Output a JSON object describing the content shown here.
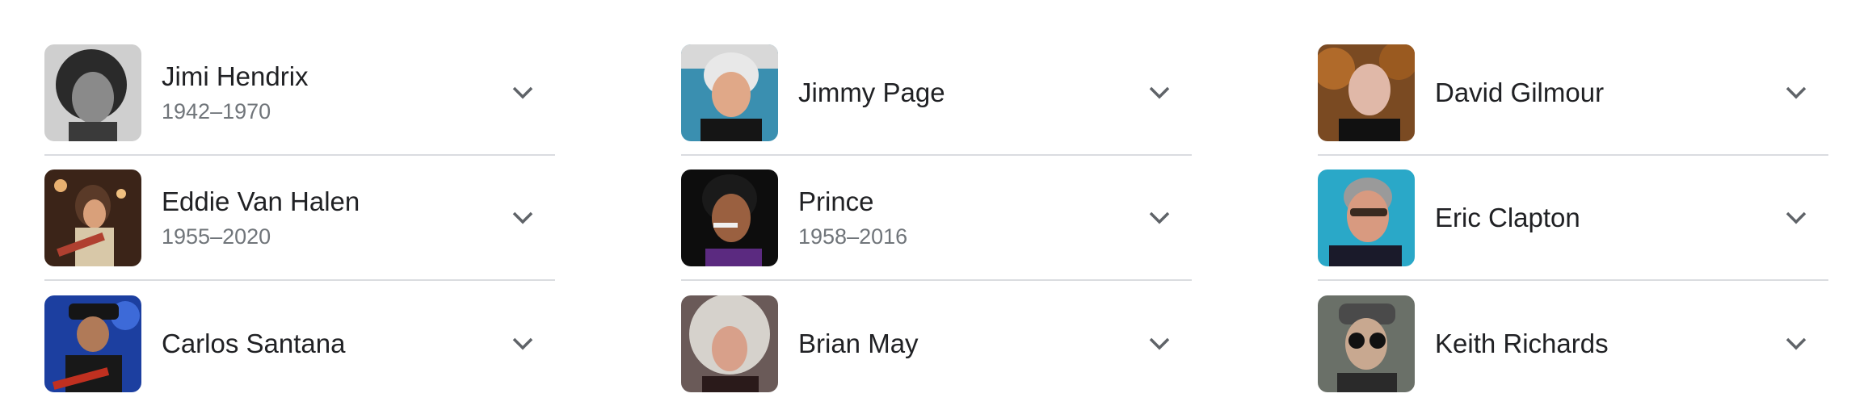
{
  "columns": [
    {
      "items": [
        {
          "name": "Jimi Hendrix",
          "years": "1942–1970",
          "photo": "jimi-hendrix-photo"
        },
        {
          "name": "Eddie Van Halen",
          "years": "1955–2020",
          "photo": "eddie-van-halen-photo"
        },
        {
          "name": "Carlos Santana",
          "years": "",
          "photo": "carlos-santana-photo"
        }
      ]
    },
    {
      "items": [
        {
          "name": "Jimmy Page",
          "years": "",
          "photo": "jimmy-page-photo"
        },
        {
          "name": "Prince",
          "years": "1958–2016",
          "photo": "prince-photo"
        },
        {
          "name": "Brian May",
          "years": "",
          "photo": "brian-may-photo"
        }
      ]
    },
    {
      "items": [
        {
          "name": "David Gilmour",
          "years": "",
          "photo": "david-gilmour-photo"
        },
        {
          "name": "Eric Clapton",
          "years": "",
          "photo": "eric-clapton-photo"
        },
        {
          "name": "Keith Richards",
          "years": "",
          "photo": "keith-richards-photo"
        }
      ]
    }
  ],
  "icons": {
    "expand": "chevron-down-icon"
  },
  "colors": {
    "text": "#202124",
    "subtext": "#70757a",
    "divider": "#dadce0",
    "chevron": "#5f6368"
  }
}
